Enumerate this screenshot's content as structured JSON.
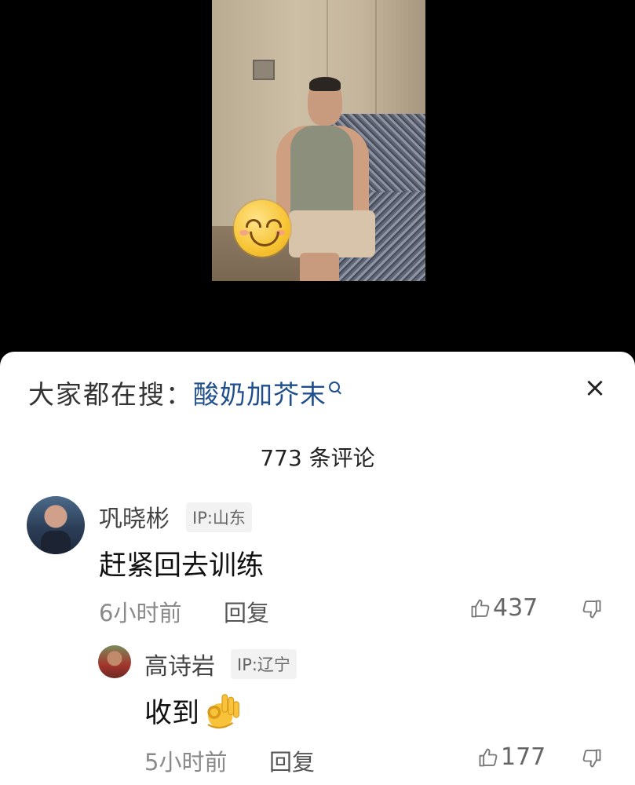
{
  "search_bar": {
    "prefix": "大家都在搜：",
    "term": "酸奶加芥末"
  },
  "close_label": "×",
  "comments_header": {
    "count_text": "773 条评论"
  },
  "comments": [
    {
      "username": "巩晓彬",
      "ip": "IP:山东",
      "text": "赶紧回去训练",
      "time": "6小时前",
      "reply_label": "回复",
      "likes": "437"
    },
    {
      "username": "高诗岩",
      "ip": "IP:辽宁",
      "text": "收到",
      "emoji": "ok-hand-emoji",
      "time": "5小时前",
      "reply_label": "回复",
      "likes": "177"
    }
  ],
  "colors": {
    "search_term": "#1f4e8c",
    "sheet_bg": "#ffffff",
    "video_bg": "#000000"
  }
}
